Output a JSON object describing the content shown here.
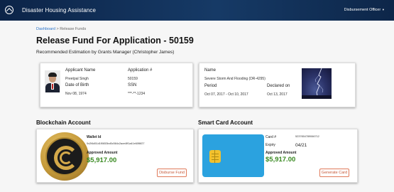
{
  "header": {
    "app_title": "Disaster Housing Assistance",
    "office_label": "Disbursement Officer",
    "logo_icon": "home-circle-icon"
  },
  "breadcrumb": {
    "home": "Dashboard",
    "separator": ">",
    "current": "Release Funds"
  },
  "page": {
    "title": "Release Fund For Application - 50159",
    "subtitle": "Recommended Estimation by Grants Manager (Christopher James)"
  },
  "applicant": {
    "name_label": "Applicant Name",
    "name": "Preetpal Singh",
    "app_no_label": "Application #",
    "app_no": "50159",
    "dob_label": "Date of Birth",
    "dob": "Nov 08, 1974",
    "ssn_label": "SSN",
    "ssn": "***-**-1234"
  },
  "disaster": {
    "name_label": "Name",
    "name": "Severe Storm And Flooding (DR-4295)",
    "period_label": "Period",
    "period": "Oct 07, 2017 - Oct 10, 2017",
    "declared_label": "Declared on",
    "declared": "Oct 13, 2017"
  },
  "blockchain": {
    "section_title": "Blockchain Account",
    "wallet_label": "Wallet Id",
    "wallet_id": "0x2f4d51d1f0653bd0c564c2ace4ff1a41e60f6f27",
    "amount_label": "Approved Amount",
    "amount": "$5,917.00",
    "button": "Disburse Fund"
  },
  "smartcard": {
    "section_title": "Smart Card Account",
    "card_label": "Card #",
    "card_no": "5237654789066712",
    "expiry_label": "Expiry",
    "expiry": "04/21",
    "amount_label": "Approved Amount",
    "amount": "$5,917.00",
    "button": "Generate Card"
  },
  "colors": {
    "header_bg": "#0c2448",
    "link": "#2a73c9",
    "amount": "#3a8a22",
    "button_accent": "#e07a5a",
    "card_blue": "#2ba2df",
    "chip": "#f2c12e"
  }
}
